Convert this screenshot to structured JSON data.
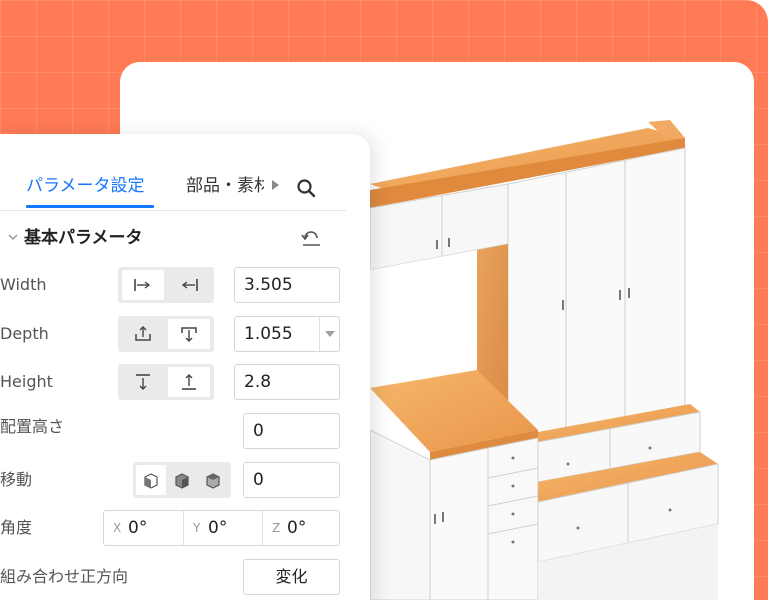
{
  "tabs": [
    {
      "label": "パラメータ設定",
      "active": true
    },
    {
      "label": "部品・素材",
      "active": false
    }
  ],
  "section": {
    "title": "基本パラメータ"
  },
  "params": {
    "width": {
      "label": "Width",
      "value": "3.505"
    },
    "depth": {
      "label": "Depth",
      "value": "1.055"
    },
    "height": {
      "label": "Height",
      "value": "2.8"
    },
    "placement_height": {
      "label": "配置高さ",
      "value": "0"
    },
    "move": {
      "label": "移動",
      "value": "0"
    },
    "angle": {
      "label": "角度",
      "x": {
        "axis": "X",
        "value": "0°"
      },
      "y": {
        "axis": "Y",
        "value": "0°"
      },
      "z": {
        "axis": "Z",
        "value": "0°"
      }
    },
    "combine": {
      "label": "組み合わせ正方向",
      "button": "変化"
    }
  },
  "icons": [
    "search-icon",
    "chevron-down-icon",
    "reset-icon",
    "align-left-icon",
    "align-right-icon",
    "align-front-icon",
    "align-back-icon",
    "align-top-icon",
    "align-bottom-icon",
    "cube-icon"
  ],
  "colors": {
    "accent": "#1677ff",
    "background": "#ff7a55",
    "wood": "#f0a85a"
  }
}
